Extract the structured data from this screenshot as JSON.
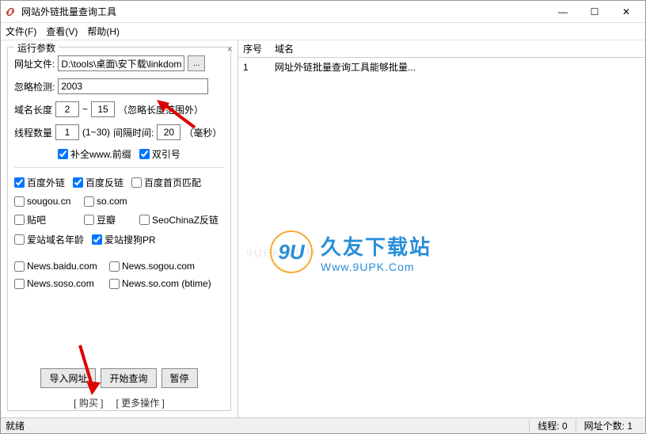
{
  "window": {
    "title": "网站外链批量查询工具"
  },
  "menu": {
    "file": "文件(F)",
    "view": "查看(V)",
    "help": "帮助(H)"
  },
  "panel": {
    "title": "运行参数",
    "file_label": "网址文件:",
    "file_value": "D:\\tools\\桌面\\安下载\\linkdomain_v",
    "browse": "...",
    "ignore_label": "忽略检测:",
    "ignore_value": "2003",
    "domain_len_label": "域名长度",
    "domain_len_min": "2",
    "domain_len_sep": "~",
    "domain_len_max": "15",
    "domain_len_note": "（忽略长度范围外）",
    "threads_label": "线程数量",
    "threads_value": "1",
    "threads_note": "(1~30)",
    "interval_label": "间隔时间:",
    "interval_value": "20",
    "interval_unit": "（毫秒）",
    "cb_www": "补全www.前缀",
    "cb_quote": "双引号",
    "cb_baidu_out": "百度外链",
    "cb_baidu_back": "百度反链",
    "cb_baidu_home": "百度首页匹配",
    "cb_sougou": "sougou.cn",
    "cb_so": "so.com",
    "cb_tieba": "贴吧",
    "cb_douban": "豆瓣",
    "cb_seochinaz": "SeoChinaZ反链",
    "cb_aizhan_age": "爱站域名年龄",
    "cb_aizhan_pr": "爱站搜狗PR",
    "cb_news_baidu": "News.baidu.com",
    "cb_news_sogou": "News.sogou.com",
    "cb_news_soso": "News.soso.com",
    "cb_news_so": "News.so.com (btime)",
    "btn_import": "导入网址",
    "btn_start": "开始查询",
    "btn_pause": "暂停",
    "link_buy": "[ 购买 ]",
    "link_more": "[ 更多操作 ]"
  },
  "table": {
    "header_seq": "序号",
    "header_domain": "域名",
    "rows": [
      {
        "seq": "1",
        "domain": "网址外链批量查询工具能够批量..."
      }
    ]
  },
  "watermark": {
    "faint": "9UPK.COM",
    "logo": "9U",
    "cn": "久友下载站",
    "en": "Www.9UPK.Com"
  },
  "status": {
    "ready": "就绪",
    "threads_label": "线程:",
    "threads_value": "0",
    "count_label": "网址个数:",
    "count_value": "1"
  }
}
